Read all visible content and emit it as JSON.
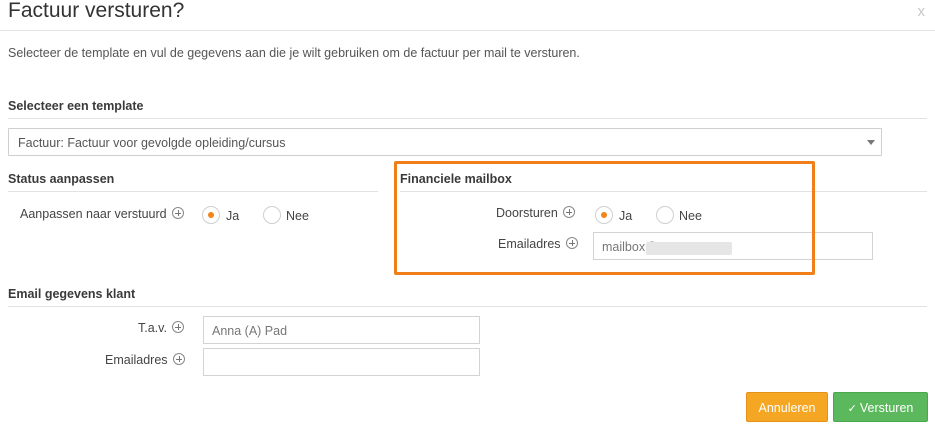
{
  "dialog": {
    "title": "Factuur versturen?",
    "close_label": "x",
    "intro": "Selecteer de template en vul de gegevens aan die je wilt gebruiken om de factuur per mail te versturen."
  },
  "template_section": {
    "title": "Selecteer een template",
    "selected": "Factuur: Factuur voor gevolgde opleiding/cursus"
  },
  "status_section": {
    "title": "Status aanpassen",
    "field_label": "Aanpassen naar verstuurd",
    "options": [
      "Ja",
      "Nee"
    ],
    "selected": "Ja"
  },
  "mailbox_section": {
    "title": "Financiele mailbox",
    "forward_label": "Doorsturen",
    "options": [
      "Ja",
      "Nee"
    ],
    "selected": "Ja",
    "email_label": "Emailadres",
    "email_value": "mailbox@"
  },
  "customer_section": {
    "title": "Email gegevens klant",
    "tav_label": "T.a.v.",
    "tav_value": "Anna (A)  Pad",
    "email_label": "Emailadres",
    "email_value": ""
  },
  "buttons": {
    "cancel": "Annuleren",
    "send": "Versturen"
  },
  "colors": {
    "accent_orange": "#f2841a",
    "highlight_border": "#f07f1a",
    "cancel_button": "#f5a623",
    "send_button": "#5cb85c"
  }
}
